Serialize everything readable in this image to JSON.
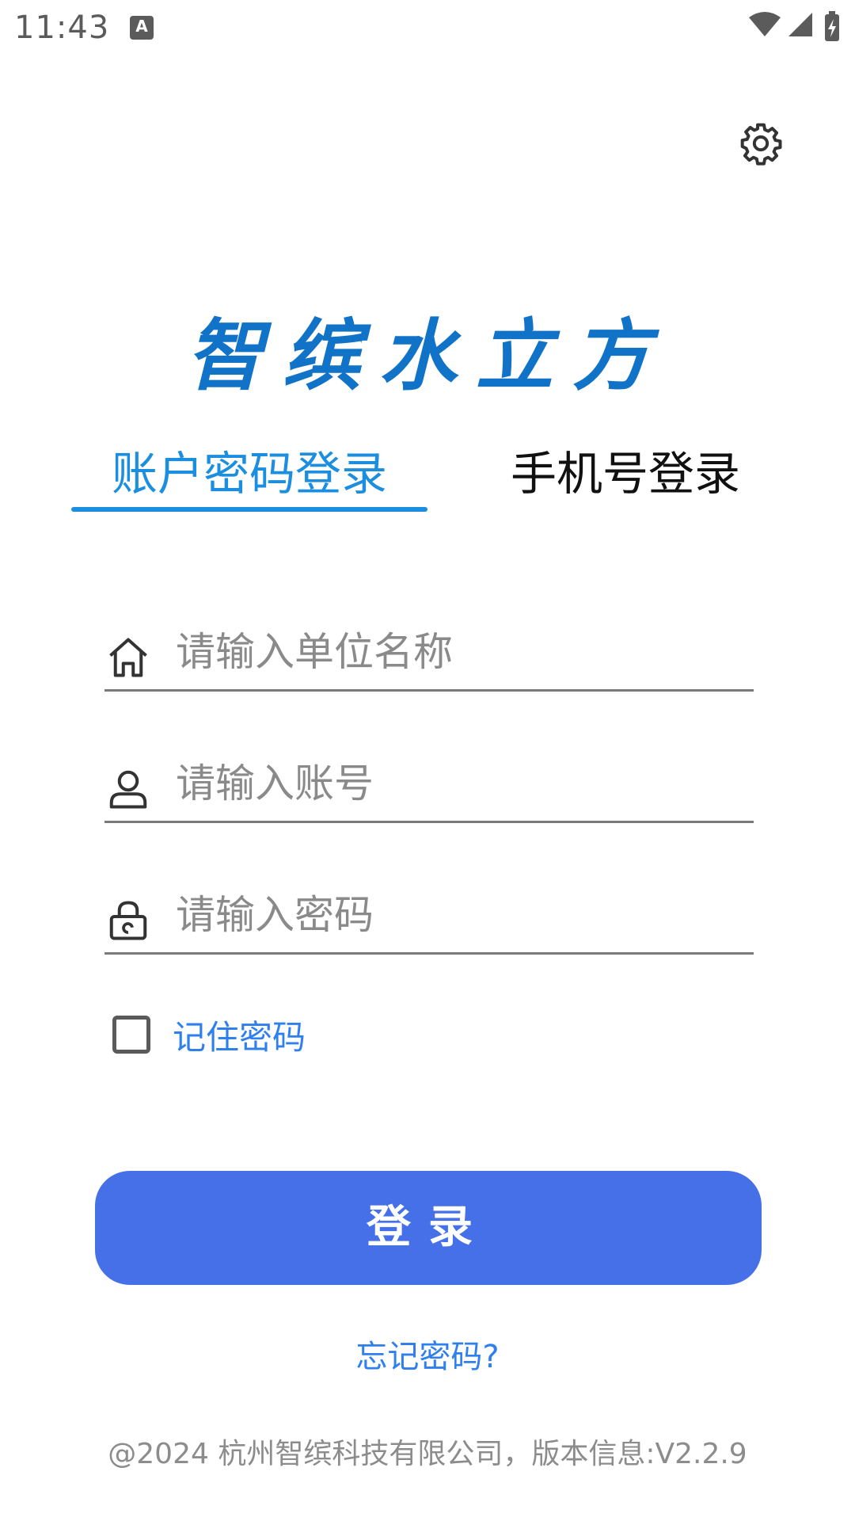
{
  "status_bar": {
    "time": "11:43",
    "notification_icon": "A",
    "icons": [
      "wifi-icon",
      "signal-icon",
      "battery-charging-icon"
    ]
  },
  "header": {
    "settings_icon": "gear-icon"
  },
  "app": {
    "title": "智缤水立方",
    "title_color": "#1173c7"
  },
  "tabs": [
    {
      "label": "账户密码登录",
      "active": true
    },
    {
      "label": "手机号登录",
      "active": false
    }
  ],
  "form": {
    "unit": {
      "icon": "home-icon",
      "placeholder": "请输入单位名称",
      "value": ""
    },
    "account": {
      "icon": "user-icon",
      "placeholder": "请输入账号",
      "value": ""
    },
    "password": {
      "icon": "lock-icon",
      "placeholder": "请输入密码",
      "value": ""
    },
    "remember": {
      "label": "记住密码",
      "checked": false
    }
  },
  "login_button": {
    "label": "登录"
  },
  "forgot_link": "忘记密码?",
  "footer": "@2024 杭州智缤科技有限公司，版本信息:V2.2.9",
  "colors": {
    "accent": "#1b8ee0",
    "button": "#4570e8",
    "link": "#2f80ee"
  }
}
